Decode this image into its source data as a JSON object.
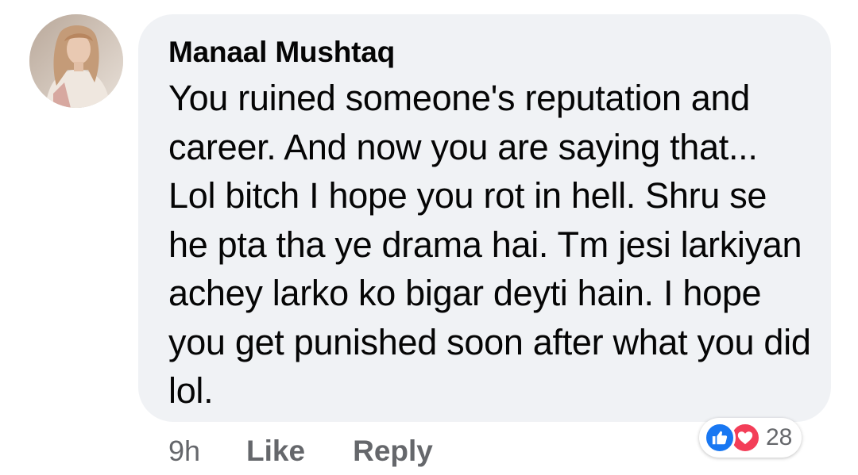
{
  "comment": {
    "author": "Manaal Mushtaq",
    "text": "You ruined someone's reputation and career. And now you are saying that... Lol bitch I hope you rot in hell. Shru se he pta tha ye drama hai. Tm jesi larkiyan achey larko ko bigar deyti hain. I hope you get punished soon after what you did lol.",
    "time": "9h",
    "like_label": "Like",
    "reply_label": "Reply",
    "reactions": {
      "count": "28",
      "icons": [
        "like-icon",
        "love-icon"
      ]
    }
  },
  "colors": {
    "bubble": "#f0f2f5",
    "text": "#050505",
    "meta": "#65676b",
    "like": "#1877f2",
    "love": "#f33e58"
  }
}
